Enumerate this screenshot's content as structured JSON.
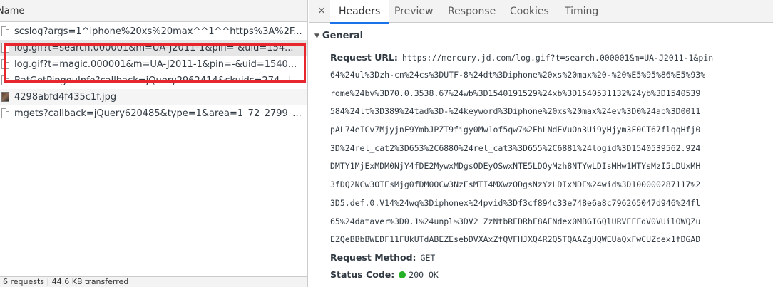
{
  "left_panel": {
    "column_header": "Name",
    "requests": [
      {
        "name": "scslog?args=1^iphone%20xs%20max^^1^^https%3A%2F..."
      },
      {
        "name": "log.gif?t=search.000001&m=UA-J2011-1&pin=-&uid=154..."
      },
      {
        "name": "log.gif?t=magic.000001&m=UA-J2011-1&pin=-&uid=1540..."
      },
      {
        "name": "BatGetPingouInfo?callback=jQuery2962414&skuids=274...l..."
      },
      {
        "name": "4298abfd4f435c1f.jpg"
      },
      {
        "name": "mgets?callback=jQuery620485&type=1&area=1_72_2799_..."
      }
    ],
    "summary": "6 requests  |  44.6 KB transferred"
  },
  "right_panel": {
    "close_symbol": "×",
    "tabs": [
      "Headers",
      "Preview",
      "Response",
      "Cookies",
      "Timing"
    ],
    "active_tab": "Headers",
    "section_title": "General",
    "request_url_label": "Request URL:",
    "request_url_lines": [
      "https://mercury.jd.com/log.gif?t=search.000001&m=UA-J2011-1&pin",
      "64%24ul%3Dzh-cn%24cs%3DUTF-8%24dt%3Diphone%20xs%20max%20-%20%E5%95%86%E5%93%",
      "rome%24bv%3D70.0.3538.67%24wb%3D1540191529%24xb%3D1540531132%24yb%3D1540539",
      "584%24lt%3D389%24tad%3D-%24keyword%3Diphone%20xs%20max%24ev%3D0%24ab%3D0011",
      "pAL74eICv7MjyjnF9YmbJPZT9figy0Mw1of5qw7%2FhLNdEVuOn3Ui9yHjym3F0CT67flqqHfj0",
      "3D%24rel_cat2%3D653%2C6880%24rel_cat3%3D655%2C6881%24logid%3D1540539562.924",
      "DMTY1MjExMDM0NjY4fDE2MywxMDgsODEyOSwxNTE5LDQyMzh8NTYwLDIsMHw1MTYsMzI5LDUxMH",
      "3fDQ2NCw3OTEsMjg0fDM0OCw3NzEsMTI4MXwzODgsNzYzLDIxNDE%24wid%3D100000287117%2",
      "3D5.def.0.V14%24wq%3Diphonex%24pvid%3Df3cf894c33e748e6a8c796265047d946%24fl",
      "65%24dataver%3D0.1%24unpl%3DV2_ZzNtbREDRhF8AENdex0MBGIGQlURVEFFdV0VUilOWQZu",
      "EZQeBBbBWEDF11FUkUTdABEZEsebDVXAxZfQVFHJXQ4R2Q5TQAAZgUQWEUaQxFwCUZcex1fDGAD"
    ],
    "request_method_label": "Request Method:",
    "request_method_value": "GET",
    "status_code_label": "Status Code:",
    "status_code_value": "200 OK",
    "status_color": "#25b028"
  }
}
